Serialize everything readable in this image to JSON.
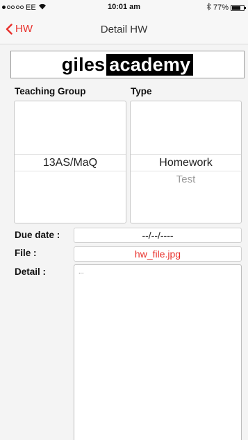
{
  "status_bar": {
    "carrier": "EE",
    "signal_bars_filled": 1,
    "signal_bars_total": 5,
    "time": "10:01 am",
    "battery_percent": "77%",
    "battery_level": 0.77
  },
  "nav": {
    "back_label": "HW",
    "title": "Detail HW"
  },
  "logo": {
    "part1": "giles",
    "part2": "academy"
  },
  "form": {
    "teaching_group_label": "Teaching Group",
    "type_label": "Type",
    "teaching_group_selected": "13AS/MaQ",
    "type_selected": "Homework",
    "type_next_option": "Test",
    "due_date_label": "Due date :",
    "due_date_value": "--/--/----",
    "file_label": "File :",
    "file_value": "hw_file.jpg",
    "detail_label": "Detail :",
    "detail_value": "..."
  },
  "colors": {
    "accent": "#e8302b",
    "background": "#f4f4f4",
    "bar": "#f7f7f7"
  },
  "icons": {
    "back": "chevron-left-icon",
    "wifi": "wifi-icon",
    "bluetooth": "bluetooth-icon",
    "battery": "battery-icon"
  }
}
